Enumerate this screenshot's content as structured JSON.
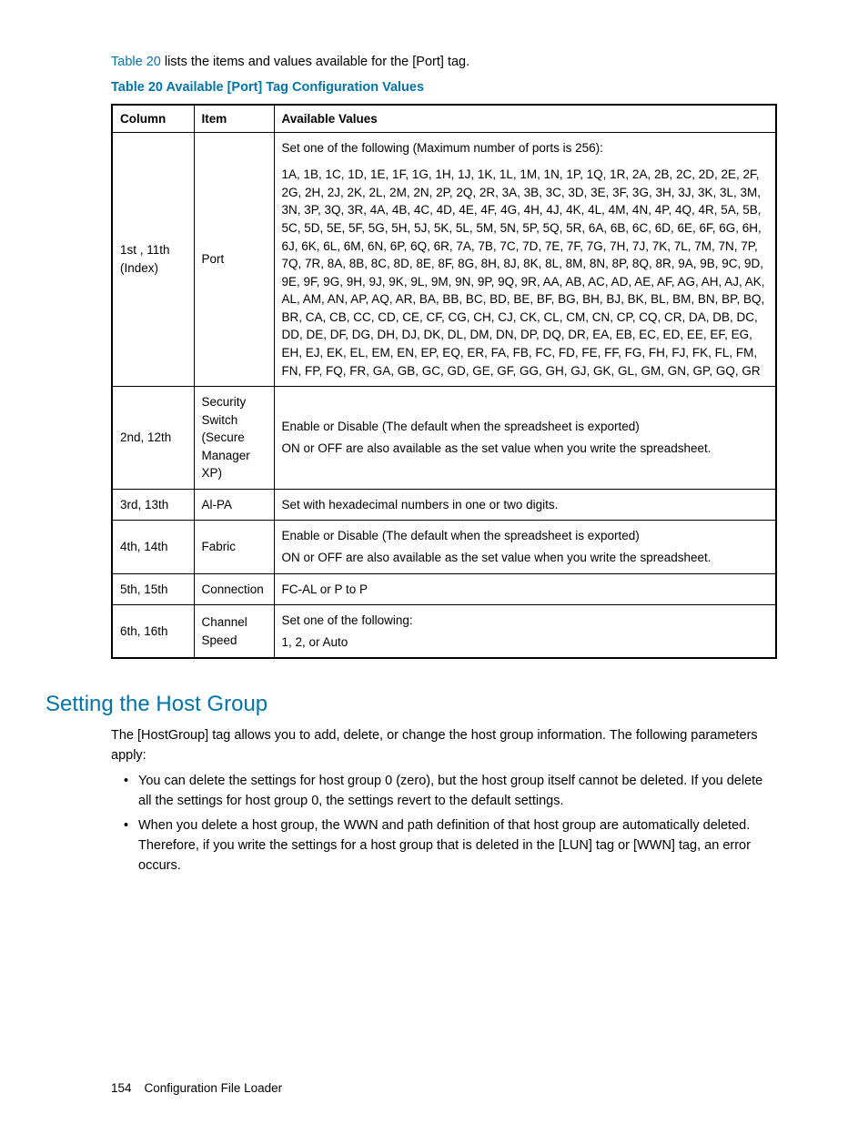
{
  "intro": {
    "link": "Table 20",
    "rest": " lists the items and values available for the [Port] tag."
  },
  "table_caption": "Table 20 Available [Port] Tag Configuration Values",
  "headers": {
    "c1": "Column",
    "c2": "Item",
    "c3": "Available Values"
  },
  "rows": [
    {
      "col": "1st , 11th (Index)",
      "item": "Port",
      "val_intro": "Set one of the following (Maximum number of ports is 256):",
      "val_list": "1A, 1B, 1C, 1D, 1E, 1F, 1G, 1H, 1J, 1K, 1L, 1M, 1N, 1P, 1Q, 1R, 2A, 2B, 2C, 2D, 2E, 2F, 2G, 2H, 2J, 2K, 2L, 2M, 2N, 2P, 2Q, 2R, 3A, 3B, 3C, 3D, 3E, 3F, 3G, 3H, 3J, 3K, 3L, 3M, 3N, 3P, 3Q, 3R, 4A, 4B, 4C, 4D, 4E, 4F, 4G, 4H, 4J, 4K, 4L, 4M, 4N, 4P, 4Q, 4R, 5A, 5B, 5C, 5D, 5E, 5F, 5G, 5H, 5J, 5K, 5L, 5M, 5N, 5P, 5Q, 5R, 6A, 6B, 6C, 6D, 6E, 6F, 6G, 6H, 6J, 6K, 6L, 6M, 6N, 6P, 6Q, 6R, 7A, 7B, 7C, 7D, 7E, 7F, 7G, 7H, 7J, 7K, 7L, 7M, 7N, 7P, 7Q, 7R, 8A, 8B, 8C, 8D, 8E, 8F, 8G, 8H, 8J, 8K, 8L, 8M, 8N, 8P, 8Q, 8R, 9A, 9B, 9C, 9D, 9E, 9F, 9G, 9H, 9J, 9K, 9L, 9M, 9N, 9P, 9Q, 9R, AA, AB, AC, AD, AE, AF, AG, AH, AJ, AK, AL, AM, AN, AP, AQ, AR, BA, BB, BC, BD, BE, BF, BG, BH, BJ, BK, BL, BM, BN, BP, BQ, BR, CA, CB, CC, CD, CE, CF, CG, CH, CJ, CK, CL, CM, CN, CP, CQ, CR, DA, DB, DC, DD, DE, DF, DG, DH, DJ, DK, DL, DM, DN, DP, DQ, DR, EA, EB, EC, ED, EE, EF, EG, EH, EJ, EK, EL, EM, EN, EP, EQ, ER, FA, FB, FC, FD, FE, FF, FG, FH, FJ, FK, FL, FM, FN, FP, FQ, FR, GA, GB, GC, GD, GE, GF, GG, GH, GJ, GK, GL, GM, GN, GP, GQ, GR"
    },
    {
      "col": "2nd, 12th",
      "item": "Security Switch (Secure Manager XP)",
      "val_l1": "Enable or Disable (The default when the spreadsheet is exported)",
      "val_l2": "ON or OFF are also available as the set value when you write the spreadsheet."
    },
    {
      "col": "3rd, 13th",
      "item": "Al-PA",
      "val": "Set with hexadecimal numbers in one or two digits."
    },
    {
      "col": "4th, 14th",
      "item": "Fabric",
      "val_l1": "Enable or Disable (The default when the spreadsheet is exported)",
      "val_l2": "ON or OFF are also available as the set value when you write the spreadsheet."
    },
    {
      "col": "5th, 15th",
      "item": "Connection",
      "val": "FC-AL or P to P"
    },
    {
      "col": "6th, 16th",
      "item": "Channel Speed",
      "val_l1": "Set one of the following:",
      "val_l2": "1, 2, or Auto"
    }
  ],
  "section_heading": "Setting the Host Group",
  "body_para": "The [HostGroup] tag allows you to add, delete, or change the host group information. The following parameters apply:",
  "bullets": [
    "You can delete the settings for host group 0 (zero), but the host group itself cannot be deleted. If you delete all the settings for host group 0, the settings revert to the default settings.",
    "When you delete a host group, the WWN and path definition of that host group are automatically deleted. Therefore, if you write the settings for a host group that is deleted in the [LUN] tag or [WWN] tag, an error occurs."
  ],
  "footer": {
    "page": "154",
    "title": "Configuration File Loader"
  }
}
